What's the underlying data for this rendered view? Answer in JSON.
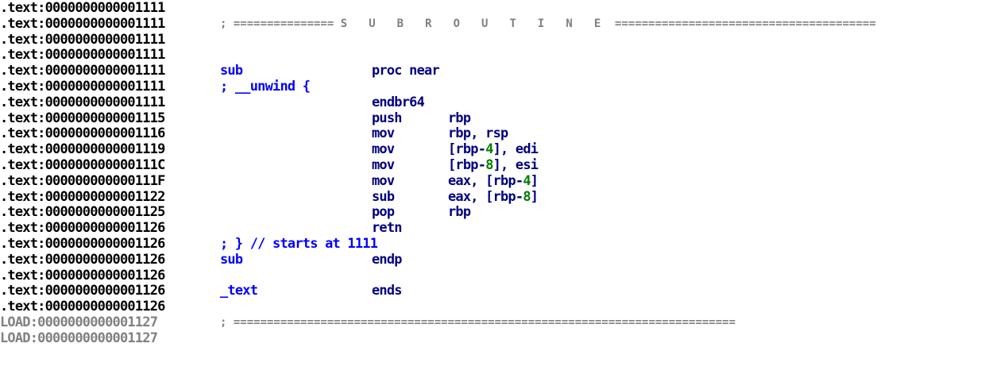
{
  "colors": {
    "address": "#000000",
    "load_address": "#808080",
    "instruction": "#000080",
    "label_comment": "#0000ff",
    "separator": "#808080",
    "immediate_number": "#008000"
  },
  "lines": [
    {
      "addr": ".text:0000000000001111"
    },
    {
      "addr": ".text:0000000000001111",
      "sep_left": "; ===============",
      "sep_title": "S U B R O U T I N E",
      "sep_right": "======================================="
    },
    {
      "addr": ".text:0000000000001111"
    },
    {
      "addr": ".text:0000000000001111"
    },
    {
      "addr": ".text:0000000000001111",
      "label": "sub",
      "mnem": "proc near"
    },
    {
      "addr": ".text:0000000000001111",
      "comment": "; __unwind {"
    },
    {
      "addr": ".text:0000000000001111",
      "mnem": "endbr64"
    },
    {
      "addr": ".text:0000000000001115",
      "mnem": "push",
      "op1": "rbp"
    },
    {
      "addr": ".text:0000000000001116",
      "mnem": "mov",
      "op1": "rbp, rsp"
    },
    {
      "addr": ".text:0000000000001119",
      "mnem": "mov",
      "op1": "[rbp-",
      "num": "4",
      "op2": "], edi"
    },
    {
      "addr": ".text:000000000000111C",
      "mnem": "mov",
      "op1": "[rbp-",
      "num": "8",
      "op2": "], esi"
    },
    {
      "addr": ".text:000000000000111F",
      "mnem": "mov",
      "op1": "eax, [rbp-",
      "num": "4",
      "op2": "]"
    },
    {
      "addr": ".text:0000000000001122",
      "mnem": "sub",
      "op1": "eax, [rbp-",
      "num": "8",
      "op2": "]"
    },
    {
      "addr": ".text:0000000000001125",
      "mnem": "pop",
      "op1": "rbp"
    },
    {
      "addr": ".text:0000000000001126",
      "mnem": "retn"
    },
    {
      "addr": ".text:0000000000001126",
      "comment": "; } // starts at 1111"
    },
    {
      "addr": ".text:0000000000001126",
      "label": "sub",
      "mnem": "endp"
    },
    {
      "addr": ".text:0000000000001126"
    },
    {
      "addr": ".text:0000000000001126",
      "label": "_text",
      "mnem": "ends"
    },
    {
      "addr": ".text:0000000000001126"
    },
    {
      "addr": "LOAD:0000000000001127",
      "sep_left": "; ==========================================================================="
    },
    {
      "addr": "LOAD:0000000000001127"
    }
  ]
}
